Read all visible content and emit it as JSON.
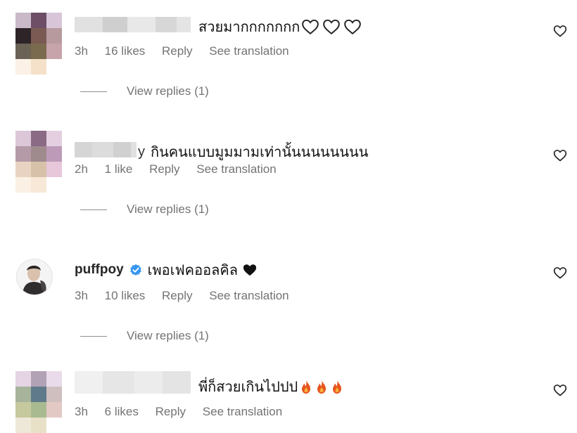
{
  "comments": [
    {
      "text": "สวยมากกกกกกก",
      "time": "3h",
      "likes": "16 likes",
      "reply": "Reply",
      "translate": "See translation",
      "view_replies": "View replies (1)"
    },
    {
      "name_fragment": "y",
      "text": "กินคนแบบมูมมามเท่านั้นนนนนนนน",
      "time": "2h",
      "likes": "1 like",
      "reply": "Reply",
      "translate": "See translation",
      "view_replies": "View replies (1)"
    },
    {
      "username": "puffpoy",
      "text": "เพอเฟคออลคิล",
      "time": "3h",
      "likes": "10 likes",
      "reply": "Reply",
      "translate": "See translation",
      "view_replies": "View replies (1)"
    },
    {
      "text": "พี่ก็สวยเกินไปปป",
      "time": "3h",
      "likes": "6 likes",
      "reply": "Reply",
      "translate": "See translation"
    }
  ],
  "colors": {
    "verified": "#3897f0",
    "fire": "#e8541e",
    "muted": "#737373"
  }
}
